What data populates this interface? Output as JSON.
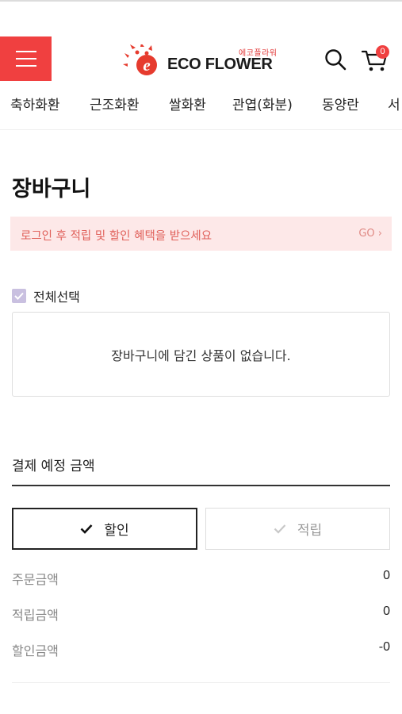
{
  "header": {
    "logo_sub": "에코플라워",
    "logo_text": "ECO FLOWER",
    "cart_count": "0",
    "icons": {
      "menu": "hamburger-menu-icon",
      "search": "search-icon",
      "cart": "cart-icon"
    },
    "accent_color": "#f04040"
  },
  "categories": [
    "축하화환",
    "근조화환",
    "쌀화환",
    "관엽(화분)",
    "동양란",
    "서"
  ],
  "page": {
    "title": "장바구니",
    "login_banner": {
      "message": "로그인 후 적립 및 할인 혜택을 받으세요",
      "go_label": "GO ›"
    },
    "select_all_label": "전체선택",
    "empty_message": "장바구니에 담긴 상품이 없습니다."
  },
  "payment": {
    "title": "결제 예정 금액",
    "tabs": [
      {
        "label": "할인",
        "selected": true
      },
      {
        "label": "적립",
        "selected": false
      }
    ],
    "summary": [
      {
        "label": "주문금액",
        "value": "0"
      },
      {
        "label": "적립금액",
        "value": "0"
      },
      {
        "label": "할인금액",
        "value": "-0"
      }
    ]
  }
}
